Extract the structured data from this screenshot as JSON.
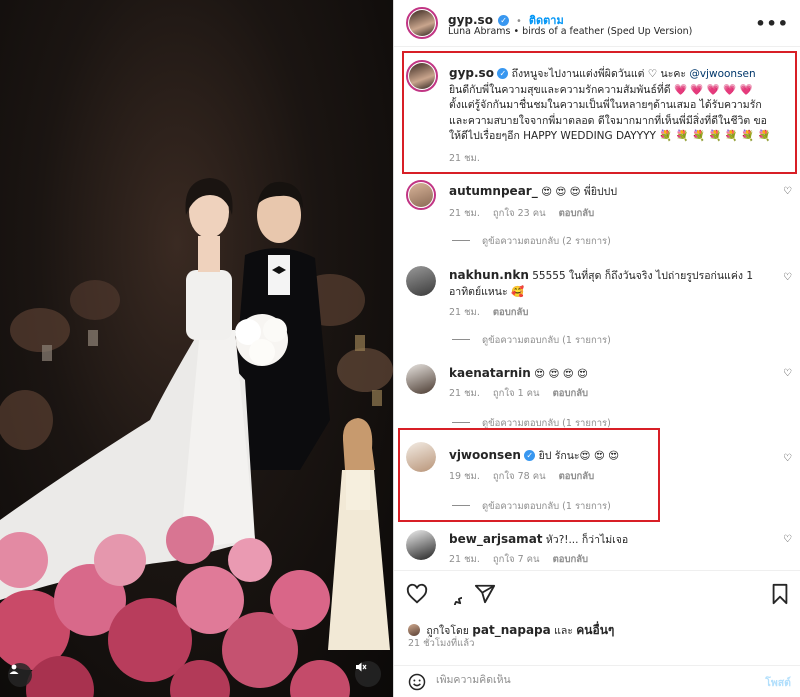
{
  "post": {
    "author": "gyp.so",
    "follow_label": "ติดตาม",
    "audio": "Luna Abrams • birds of a feather (Sped Up Version)",
    "more_label": "•••"
  },
  "caption": {
    "username": "gyp.so",
    "text_before": "ถึงหนูจะไปงานแต่งพี่ผิดวันแต่ ♡ นะคะ ",
    "mention": "@vjwoonsen",
    "text_after": " ยินดีกับพี่ในความสุขและความรักความสัมพันธ์ที่ดี 💗 💗 💗 💗 💗 ตั้งแต่รู้จักกันมาชื่นชมในความเป็นพี่ในหลายๆด้านเสมอ ได้รับความรักและความสบายใจจากพี่มาตลอด ดีใจมากมากที่เห็นพี่มีสิ่งที่ดีในชีวิต ขอให้ดีไปเรื่อยๆอีก HAPPY WEDDING DAYYYY 💐 💐 💐 💐 💐 💐 💐",
    "time": "21 ชม."
  },
  "comments": [
    {
      "username": "autumnpear_",
      "text": "😍 😍 😍 พี่ยิปปป",
      "time": "21 ชม.",
      "likes": "ถูกใจ 23 คน",
      "reply": "ตอบกลับ",
      "view_replies": "ดูข้อความตอบกลับ (2 รายการ)"
    },
    {
      "username": "nakhun.nkn",
      "text": "55555 ในที่สุด ก็ถึงวันจริง ไปถ่ายรูปรอก่นแค่ง 1 อาทิตย์แหนะ 🥰",
      "time": "21 ชม.",
      "likes": "",
      "reply": "ตอบกลับ",
      "view_replies": "ดูข้อความตอบกลับ (1 รายการ)"
    },
    {
      "username": "kaenatarnin",
      "text": "😍 😍 😍 😍",
      "time": "21 ชม.",
      "likes": "ถูกใจ 1 คน",
      "reply": "ตอบกลับ",
      "view_replies": "ดูข้อความตอบกลับ (1 รายการ)"
    },
    {
      "username": "vjwoonsen",
      "text": "ยิป รักนะ😍 😍 😍",
      "time": "19 ชม.",
      "likes": "ถูกใจ 78 คน",
      "reply": "ตอบกลับ",
      "view_replies": "ดูข้อความตอบกลับ (1 รายการ)"
    },
    {
      "username": "bew_arjsamat",
      "text": "หัว?!... ก็ว่าไม่เจอ",
      "time": "21 ชม.",
      "likes": "ถูกใจ 7 คน",
      "reply": "ตอบกลับ",
      "view_replies": ""
    }
  ],
  "actions": {
    "liked_by_prefix": "ถูกใจโดย",
    "liked_by_user": "pat_napapa",
    "liked_by_and": "และ",
    "liked_by_others": "คนอื่นๆ",
    "time_ago": "21 ชั่วโมงที่แล้ว"
  },
  "add_comment": {
    "placeholder": "เพิ่มความคิดเห็น",
    "post_label": "โพสต์"
  },
  "colors": {
    "highlight": "#d81f26",
    "link": "#0095f6",
    "verified": "#3897f0"
  }
}
